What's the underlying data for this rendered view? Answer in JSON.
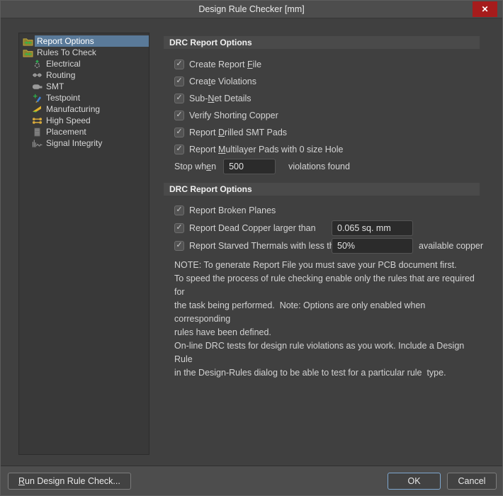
{
  "colors": {
    "selection_blue": "#5a7a99",
    "ok_accent_border": "#7fa8d0",
    "close_button_red": "#a61c1c",
    "dialog_bg": "#404040",
    "panel_bg": "#393939",
    "header_bar_bg": "#4a4a4a",
    "input_bg": "#2b2b2b"
  },
  "icons": {
    "close": "✕",
    "check": "✓"
  },
  "window": {
    "title": "Design Rule Checker [mm]"
  },
  "sidebar": {
    "selected": "Report Options",
    "items": [
      {
        "label": "Report Options"
      },
      {
        "label": "Rules To Check"
      },
      {
        "label": "Electrical"
      },
      {
        "label": "Routing"
      },
      {
        "label": "SMT"
      },
      {
        "label": "Testpoint"
      },
      {
        "label": "Manufacturing"
      },
      {
        "label": "High Speed"
      },
      {
        "label": "Placement"
      },
      {
        "label": "Signal Integrity"
      }
    ]
  },
  "report_options_1": {
    "header": "DRC Report Options",
    "items": [
      {
        "pre": "Create Report ",
        "key": "F",
        "post": "ile",
        "checked": true
      },
      {
        "pre": "Crea",
        "key": "t",
        "post": "e Violations",
        "checked": true
      },
      {
        "pre": "Sub-",
        "key": "N",
        "post": "et Details",
        "checked": true
      },
      {
        "pre": "Verify Shorting Copper",
        "key": "",
        "post": "",
        "checked": true
      },
      {
        "pre": "Report ",
        "key": "D",
        "post": "rilled SMT Pads",
        "checked": true
      },
      {
        "pre": "Report ",
        "key": "M",
        "post": "ultilayer Pads with 0 size Hole",
        "checked": true
      }
    ],
    "stop_when": {
      "pre": "Stop wh",
      "key": "e",
      "post": "n",
      "value": "500",
      "after": "violations found"
    }
  },
  "report_options_2": {
    "header": "DRC Report Options",
    "items": [
      {
        "label": "Report Broken Planes",
        "checked": true
      },
      {
        "label": "Report Dead Copper larger than",
        "checked": true,
        "value": "0.065 sq. mm"
      },
      {
        "label": "Report Starved Thermals with less than",
        "checked": true,
        "value": "50%",
        "after": "available copper"
      }
    ]
  },
  "note": {
    "lines": [
      "NOTE: To generate Report File you must save your PCB document first.",
      "To speed the process of rule checking enable only the rules that are required for",
      "the task being performed.  Note: Options are only enabled when corresponding",
      "rules have been defined.",
      "On-line DRC tests for design rule violations as you work. Include a Design Rule",
      "in the Design-Rules dialog to be able to test for a particular rule  type."
    ]
  },
  "footer": {
    "run": {
      "pre": "",
      "key": "R",
      "post": "un Design Rule Check..."
    },
    "ok": "OK",
    "cancel": "Cancel"
  }
}
